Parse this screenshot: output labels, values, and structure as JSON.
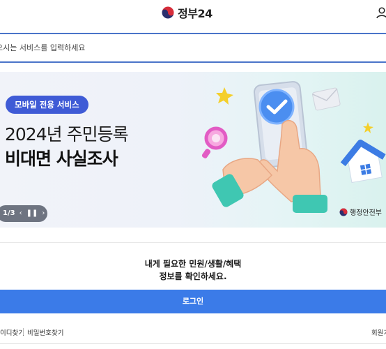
{
  "header": {
    "logo_text": "정부24",
    "user_icon": "user-icon"
  },
  "search": {
    "placeholder": "으시는 서비스를 입력하세요"
  },
  "banner": {
    "tag": "모바일 전용 서비스",
    "title_line1": "2024년 주민등록",
    "title_line2": "비대면 사실조사",
    "page": "1/3",
    "prev_icon": "chevron-left-icon",
    "pause_icon": "pause-icon",
    "next_icon": "chevron-right-icon",
    "ministry": "행정안전부"
  },
  "login_panel": {
    "message_line1": "내게 필요한 민원/생활/혜택",
    "message_line2": "정보를 확인하세요.",
    "login_label": "로그인"
  },
  "footer_links": {
    "find_id": "이디찾기",
    "find_password": "비밀번호찾기",
    "signup": "회원가"
  },
  "colors": {
    "accent_blue": "#3b7be8",
    "tag_blue": "#3f5bd6",
    "search_border": "#4a74c9"
  }
}
